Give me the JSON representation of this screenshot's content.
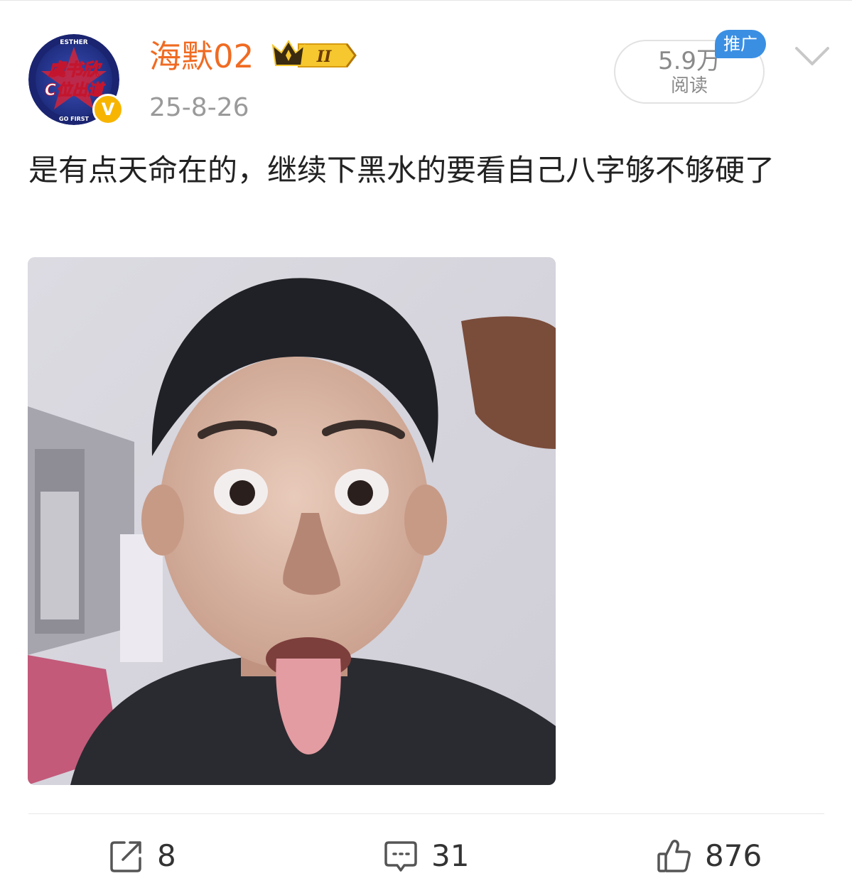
{
  "post": {
    "author": {
      "name": "海默02",
      "avatar_label": "avatar-show-logo",
      "avatar_logo_text": "虞书欣",
      "avatar_logo_text_2": "C位出道",
      "avatar_ring_top": "ESTHER",
      "avatar_ring_bottom": "GO FIRST",
      "verified_mark": "V",
      "rank_badge_text": "II"
    },
    "timestamp": "25-8-26",
    "read_count": "5.9万",
    "read_label": "阅读",
    "promo_label": "推广",
    "text": "是有点天命在的，继续下黑水的要看自己八字够不够硬了"
  },
  "actions": {
    "repost_count": "8",
    "comment_count": "31",
    "like_count": "876"
  },
  "icons": {
    "repost": "share-icon",
    "comment": "comment-icon",
    "like": "thumbs-up-icon",
    "more": "chevron-down-icon"
  },
  "colors": {
    "username": "#f06b22",
    "promo_badge": "#3b8fe3",
    "verified": "#f7b500",
    "text": "#222222",
    "meta": "#9a9a9a"
  }
}
